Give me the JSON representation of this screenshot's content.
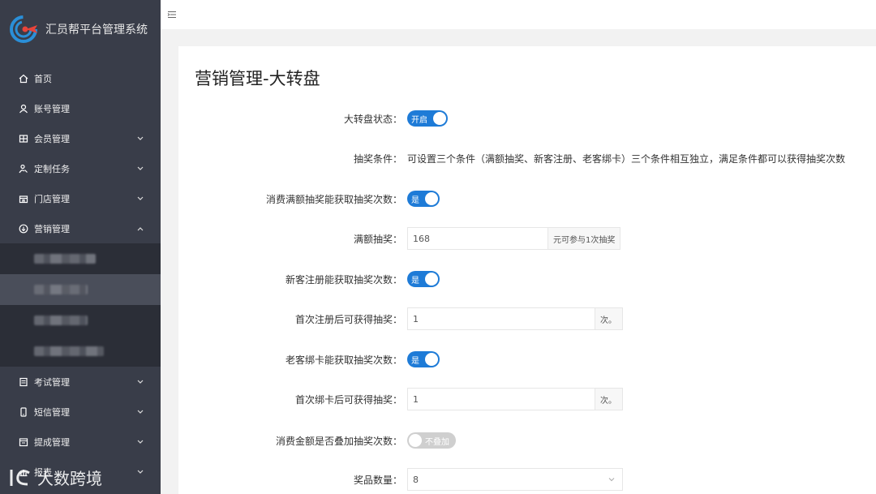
{
  "app": {
    "brand_name": "汇员帮平台管理系统",
    "colors": {
      "sidebar_bg": "#393d49",
      "accent": "#1e7bd7",
      "logo_red": "#e8443a",
      "logo_blue": "#2a8fd8"
    }
  },
  "sidebar": {
    "items": [
      {
        "label": "首页",
        "icon": "home-icon"
      },
      {
        "label": "账号管理",
        "icon": "user-icon"
      },
      {
        "label": "会员管理",
        "icon": "members-icon"
      },
      {
        "label": "定制任务",
        "icon": "task-icon"
      },
      {
        "label": "门店管理",
        "icon": "store-icon"
      },
      {
        "label": "营销管理",
        "icon": "marketing-icon"
      },
      {
        "label": "考试管理",
        "icon": "exam-icon"
      },
      {
        "label": "短信管理",
        "icon": "phone-icon"
      },
      {
        "label": "提成管理",
        "icon": "commission-icon"
      },
      {
        "label": "报表",
        "icon": "report-icon"
      }
    ]
  },
  "page": {
    "title": "营销管理-大转盘",
    "fields": {
      "wheel_status": {
        "label": "大转盘状态：",
        "switch_text": "开启"
      },
      "draw_conditions": {
        "label": "抽奖条件：",
        "text": "可设置三个条件（满额抽奖、新客注册、老客绑卡）三个条件相互独立，满足条件都可以获得抽奖次数"
      },
      "spend_draw": {
        "label": "消费满额抽奖能获取抽奖次数：",
        "switch_text": "是"
      },
      "full_amount": {
        "label": "满额抽奖：",
        "value": "168",
        "addon": "元可参与1次抽奖"
      },
      "new_register": {
        "label": "新客注册能获取抽奖次数：",
        "switch_text": "是"
      },
      "first_register": {
        "label": "首次注册后可获得抽奖：",
        "value": "1",
        "addon": "次。"
      },
      "old_bind": {
        "label": "老客绑卡能获取抽奖次数：",
        "switch_text": "是"
      },
      "first_bind": {
        "label": "首次绑卡后可获得抽奖：",
        "value": "1",
        "addon": "次。"
      },
      "stack_spend": {
        "label": "消费金额是否叠加抽奖次数：",
        "switch_text": "不叠加"
      },
      "prize_count": {
        "label": "奖品数量：",
        "value": "8"
      }
    }
  },
  "watermark": {
    "text": "大数跨境"
  }
}
